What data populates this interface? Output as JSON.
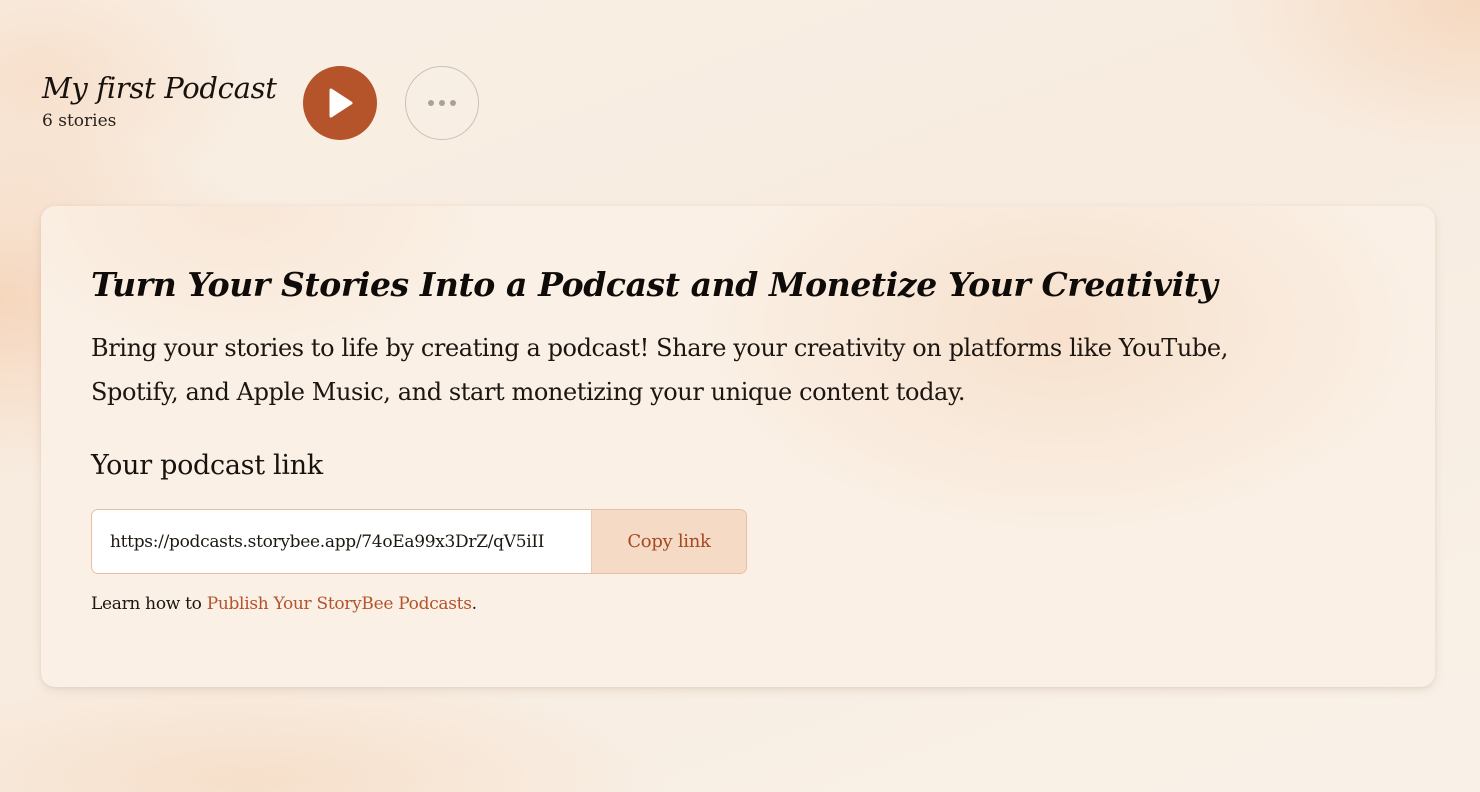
{
  "header": {
    "title": "My first Podcast",
    "story_count": "6 stories",
    "play_icon": "play-icon",
    "more_icon": "more-horizontal-icon"
  },
  "promo": {
    "title": "Turn Your Stories Into a Podcast and Monetize Your Creativity",
    "description": "Bring your stories to life by creating a podcast! Share your creativity on platforms like YouTube, Spotify, and Apple Music, and start monetizing your unique content today.",
    "link_label": "Your podcast link",
    "link_value": "https://podcasts.storybee.app/74oEa99x3DrZ/qV5iII",
    "copy_button": "Copy link",
    "help_prefix": "Learn how to ",
    "help_link": "Publish Your StoryBee Podcasts",
    "help_suffix": "."
  },
  "colors": {
    "accent": "#b5532a",
    "copy_button_bg": "#f5dac5",
    "background": "#f8eee3",
    "card_bg": "#faf0e5"
  }
}
